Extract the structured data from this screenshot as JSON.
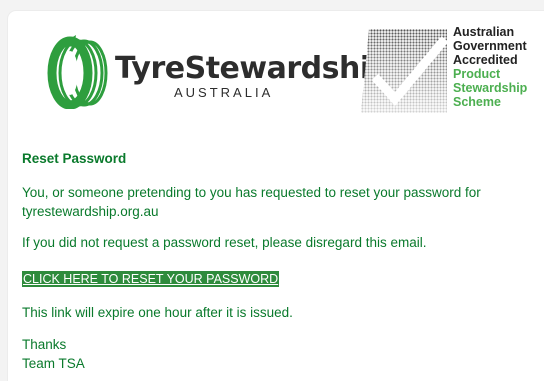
{
  "header": {
    "brand_name": "TyreStewardship",
    "brand_sub": "AUSTRALIA",
    "accreditation": {
      "line1": "Australian",
      "line2": "Government",
      "line3": "Accredited",
      "line4": "Product",
      "line5": "Stewardship",
      "line6": "Scheme"
    }
  },
  "email": {
    "title": "Reset Password",
    "para1": "You, or someone pretending to you has requested to reset your password for tyrestewardship.org.au",
    "para2": "If you did not request a password reset, please disregard this email.",
    "link_label": "CLICK HERE TO RESET YOUR PASSWORD",
    "para3": "This link will expire one hour after it is issued.",
    "thanks": "Thanks",
    "signature": "Team TSA"
  },
  "colors": {
    "brand_green": "#2e9e3e",
    "text_green": "#0a7a2c",
    "accred_green": "#4caf50",
    "link_bg": "#2e8b3c"
  },
  "icons": {
    "tyre_logo": "tyre-stewardship-logo-icon",
    "accred_mark": "checkmark-accreditation-icon"
  }
}
